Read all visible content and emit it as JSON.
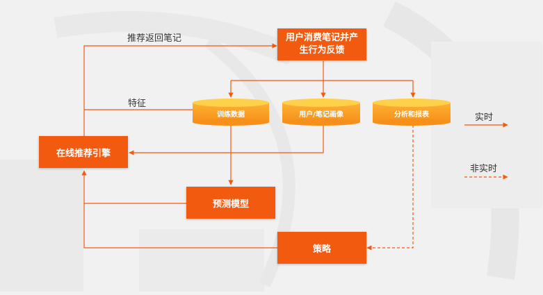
{
  "nodes": {
    "user_behavior": "用户消费笔记并产\n生行为反馈",
    "training_data": "训练数据",
    "user_note_profile": "用户/笔记画像",
    "analysis_report": "分析和报表",
    "online_engine": "在线推荐引擎",
    "prediction_model": "预测模型",
    "strategy": "策略"
  },
  "edge_labels": {
    "recommend_notes": "推荐返回笔记",
    "features": "特征"
  },
  "legend": {
    "realtime": "实时",
    "non_realtime": "非实时"
  },
  "colors": {
    "node": "#f25a10",
    "cylinder_top": "#ffcf3a",
    "cylinder_body": "#fa9a18",
    "line": "#f25a10"
  }
}
